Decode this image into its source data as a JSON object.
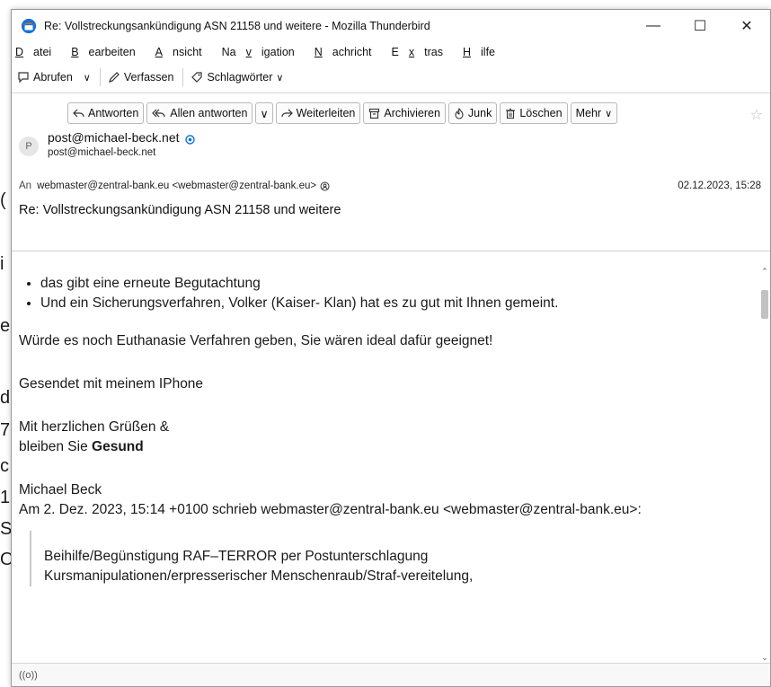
{
  "background_glyphs": [
    "(",
    "i",
    "e",
    "d",
    "7",
    "c",
    "1",
    "S",
    "O"
  ],
  "window": {
    "title": "Re: Vollstreckungsankündigung ASN 21158 und weitere - Mozilla Thunderbird",
    "controls": {
      "minimize": "—",
      "maximize": "☐",
      "close": "✕"
    }
  },
  "menu": {
    "items": [
      {
        "first": "D",
        "rest": "atei"
      },
      {
        "first": "B",
        "rest": "earbeiten"
      },
      {
        "first": "A",
        "rest": "nsicht"
      },
      {
        "pre": "Na",
        "first": "v",
        "rest": "igation"
      },
      {
        "first": "N",
        "rest": "achricht"
      },
      {
        "pre": "E",
        "first": "x",
        "rest": "tras"
      },
      {
        "first": "H",
        "rest": "ilfe"
      }
    ]
  },
  "toolbar": {
    "fetch": "Abrufen",
    "compose": "Verfassen",
    "tags": "Schlagwörter"
  },
  "actions": {
    "reply": "Antworten",
    "reply_all": "Allen antworten",
    "forward": "Weiterleiten",
    "archive": "Archivieren",
    "junk": "Junk",
    "delete": "Löschen",
    "more": "Mehr"
  },
  "message": {
    "avatar_letter": "P",
    "from_name": "post@michael-beck.net",
    "from_address": "post@michael-beck.net",
    "to_label": "An",
    "to": "webmaster@zentral-bank.eu <webmaster@zentral-bank.eu>",
    "date": "02.12.2023, 15:28",
    "subject": "Re: Vollstreckungsankündigung ASN 21158 und weitere"
  },
  "body": {
    "bullets": [
      "das gibt eine erneute Begutachtung",
      "Und ein Sicherungsverfahren, Volker (Kaiser- Klan) hat es zu gut mit Ihnen gemeint."
    ],
    "line_euthanasie": "Würde es noch Euthanasie Verfahren geben, Sie wären ideal dafür geeignet!",
    "sent_from": "Gesendet mit meinem IPhone",
    "greeting_1": "Mit herzlichen Grüßen &",
    "greeting_2_pre": "bleiben Sie ",
    "greeting_2_bold": "Gesund",
    "signature": "Michael Beck",
    "quote_intro": "Am 2. Dez. 2023, 15:14 +0100 schrieb webmaster@zentral-bank.eu <webmaster@zentral-bank.eu>:",
    "quote_line_1": "Beihilfe/Begünstigung RAF–TERROR per Postunterschlagung",
    "quote_line_2": "Kursmanipulationen/erpresserischer Menschenraub/Straf-vereitelung,"
  },
  "status": {
    "icon_text": "((o))"
  },
  "colors": {
    "accent_blue": "#1373d9",
    "thunderbird_orange": "#e86a1a"
  }
}
